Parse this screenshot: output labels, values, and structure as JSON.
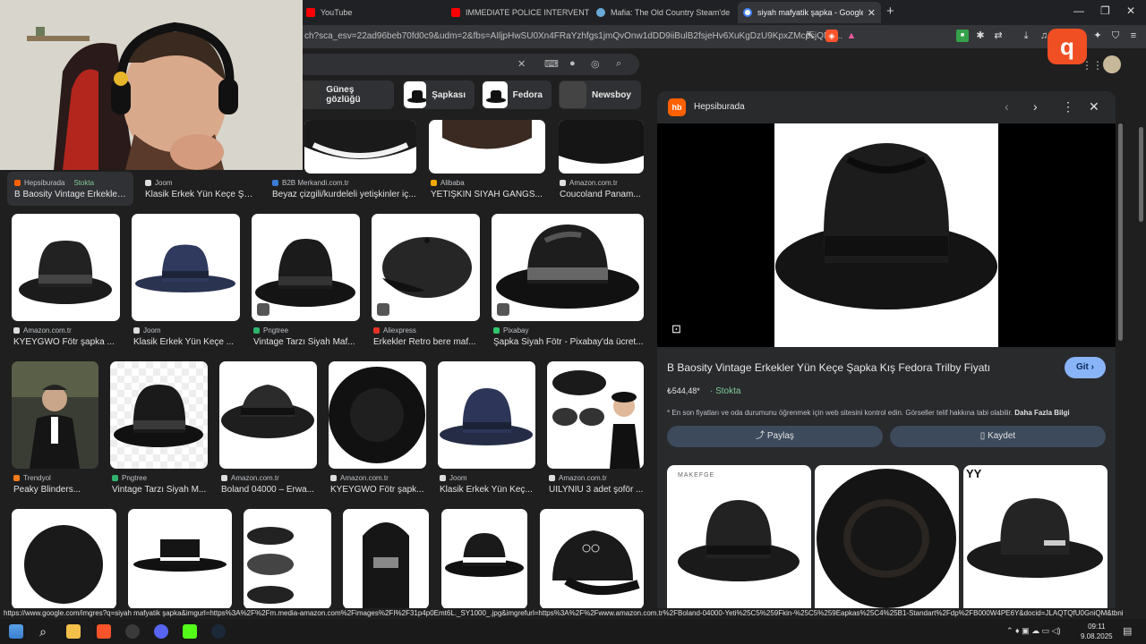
{
  "tabs": [
    {
      "title": "YouTube",
      "color": "#ff0000"
    },
    {
      "title": "IMMEDIATE POLICE INTERVENTION!",
      "color": "#ff0000"
    },
    {
      "title": "Mafia: The Old Country Steam'de",
      "color": "#1b2838"
    },
    {
      "title": "siyah mafyatik şapka - Google'da",
      "color": "#4285f4"
    }
  ],
  "address": {
    "url": "ch?sca_esv=22ad96beb70fd0c9&udm=2&fbs=AIljpHwSU0Xn4FRaYzhfgs1jmQvOnw1dDD9iiBulB2fsjeHv6XuKgDzU9KpxZMcpsjQNb..."
  },
  "chips": [
    "Güneş gözlüğü",
    "Şapkası",
    "Fedora",
    "Newsboy"
  ],
  "results": {
    "row1": [
      {
        "source": "Hepsiburada",
        "badge": "Stokta",
        "title": "B Baosity Vintage Erkekler ..."
      },
      {
        "source": "Joom",
        "title": "Klasik Erkek Yün Keçe Şa..."
      },
      {
        "source": "B2B Merkandi.com.tr",
        "title": "Beyaz çizgili/kurdeleli yetişkinler iç..."
      },
      {
        "source": "Alibaba",
        "title": "YETIŞKIN SIYAH GANGS..."
      },
      {
        "source": "Amazon.com.tr",
        "title": "Coucoland Panam..."
      }
    ],
    "row2": [
      {
        "source": "Amazon.com.tr",
        "title": "KYEYGWO Fötr şapka ..."
      },
      {
        "source": "Joom",
        "title": "Klasik Erkek Yün Keçe ..."
      },
      {
        "source": "Pngtree",
        "title": "Vintage Tarzı Siyah Maf..."
      },
      {
        "source": "Aliexpress",
        "title": "Erkekler Retro bere maf..."
      },
      {
        "source": "Pixabay",
        "title": "Şapka Siyah Fötr - Pixabay'da ücret..."
      }
    ],
    "row3": [
      {
        "source": "Trendyol",
        "title": "Peaky Blinders..."
      },
      {
        "source": "Pngtree",
        "title": "Vintage Tarzı Siyah M..."
      },
      {
        "source": "Amazon.com.tr",
        "title": "Boland 04000 – Erwa..."
      },
      {
        "source": "Amazon.com.tr",
        "title": "KYEYGWO Fötr şapk..."
      },
      {
        "source": "Joom",
        "title": "Klasik Erkek Yün Keç..."
      },
      {
        "source": "Amazon.com.tr",
        "title": "UILYNIU 3 adet şoför ..."
      }
    ]
  },
  "panel": {
    "logo": "hb",
    "site": "Hepsiburada",
    "title": "B Baosity Vintage Erkekler Yün Keçe Şapka Kış Fedora Trilby Fiyatı",
    "go": "Git",
    "price": "₺544,48*",
    "stock": "Stokta",
    "note": "* En son fiyatları ve oda durumunu öğrenmek için web sitesini kontrol edin. Görseller telif hakkına tabi olabilir.",
    "note_link": "Daha Fazla Bilgi",
    "share": "Paylaş",
    "save": "Kaydet",
    "related_labels": [
      "MAKEFGE",
      "YY"
    ]
  },
  "status_url": "https://www.google.com/imgres?q=siyah mafyatik şapka&imgurl=https%3A%2F%2Fm.media-amazon.com%2Fimages%2FI%2F31p4p0Emt6L._SY1000_.jpg&imgrefurl=https%3A%2F%2Fwww.amazon.com.tr%2FBoland-04000-Yeti%25C5%259Fkin-%25C5%259Eapkas%25C4%25B1-Standart%2Fdp%2FB000W4PE6Y&docid=JLAQTQfU0GniQM&tbnid=Wm...",
  "clock": {
    "time": "09:11",
    "date": "9.08.2025"
  },
  "overlay_logo": "q"
}
